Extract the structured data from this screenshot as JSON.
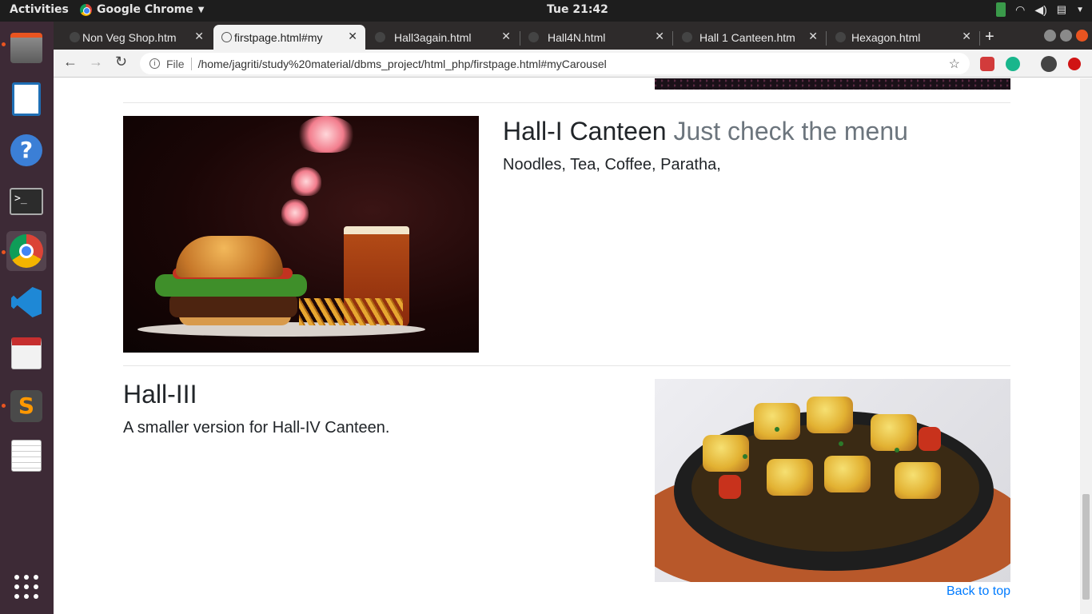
{
  "system": {
    "activities": "Activities",
    "app_name": "Google Chrome",
    "clock": "Tue 21:42"
  },
  "browser": {
    "tabs": [
      {
        "label": "Non Veg Shop.htm",
        "active": false
      },
      {
        "label": "firstpage.html#my",
        "active": true
      },
      {
        "label": "Hall3again.html",
        "active": false
      },
      {
        "label": "Hall4N.html",
        "active": false
      },
      {
        "label": "Hall 1 Canteen.htm",
        "active": false
      },
      {
        "label": "Hexagon.html",
        "active": false
      }
    ],
    "url_scheme_label": "File",
    "url": "/home/jagriti/study%20material/dbms_project/html_php/firstpage.html#myCarousel"
  },
  "page": {
    "section1": {
      "heading": "Hall-I Canteen",
      "heading_muted": "Just check the menu",
      "lead": "Noodles, Tea, Coffee, Paratha,"
    },
    "section2": {
      "heading": "Hall-III",
      "lead": "A smaller version for Hall-IV Canteen."
    },
    "back_to_top": "Back to top"
  },
  "colors": {
    "link": "#007bff",
    "muted_text": "#6c757d",
    "body_text": "#212529",
    "dock": "#3d2a36",
    "tabstrip": "#2e2b2b"
  }
}
